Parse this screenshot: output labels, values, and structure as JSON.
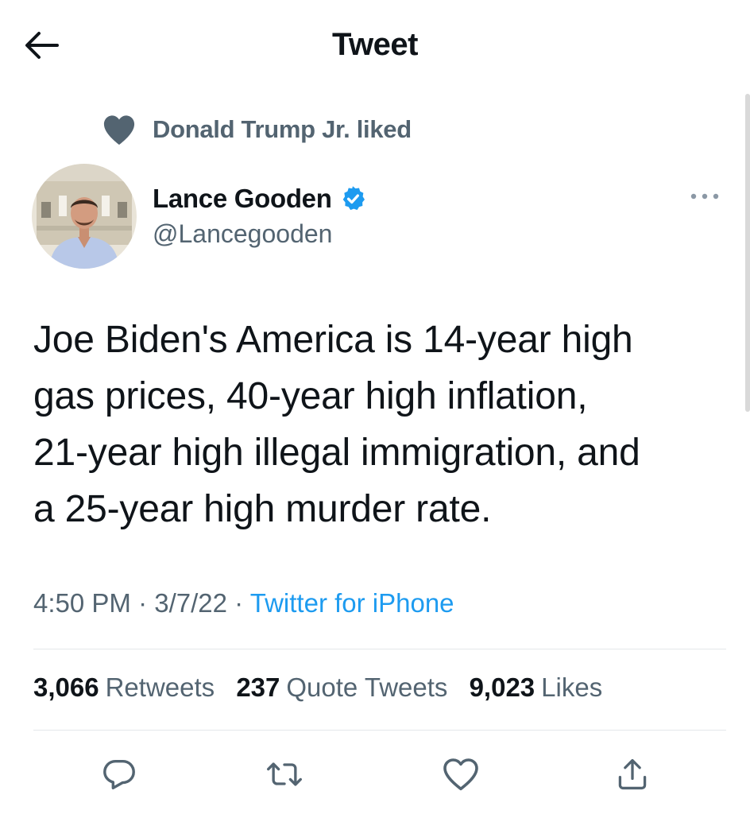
{
  "header": {
    "title": "Tweet",
    "back_icon": "arrow-left-icon"
  },
  "social_context": {
    "text": "Donald Trump Jr. liked",
    "icon": "heart-filled-icon"
  },
  "author": {
    "name": "Lance Gooden",
    "handle": "@Lancegooden",
    "verified": true
  },
  "tweet": {
    "lines": [
      "Joe Biden's America is 14-year high",
      "gas prices, 40-year high inflation,",
      "21-year high illegal immigration, and",
      "a 25-year high murder rate."
    ]
  },
  "meta": {
    "time": "4:50 PM",
    "date": "3/7/22",
    "source": "Twitter for iPhone",
    "sep": "·"
  },
  "stats": {
    "retweets_count": "3,066",
    "retweets_label": "Retweets",
    "quotes_count": "237",
    "quotes_label": "Quote Tweets",
    "likes_count": "9,023",
    "likes_label": "Likes"
  },
  "actions": [
    "reply-icon",
    "retweet-icon",
    "like-icon",
    "share-icon"
  ],
  "colors": {
    "accent": "#1d9bf0",
    "secondary_text": "#536471",
    "primary_text": "#0f1419"
  }
}
